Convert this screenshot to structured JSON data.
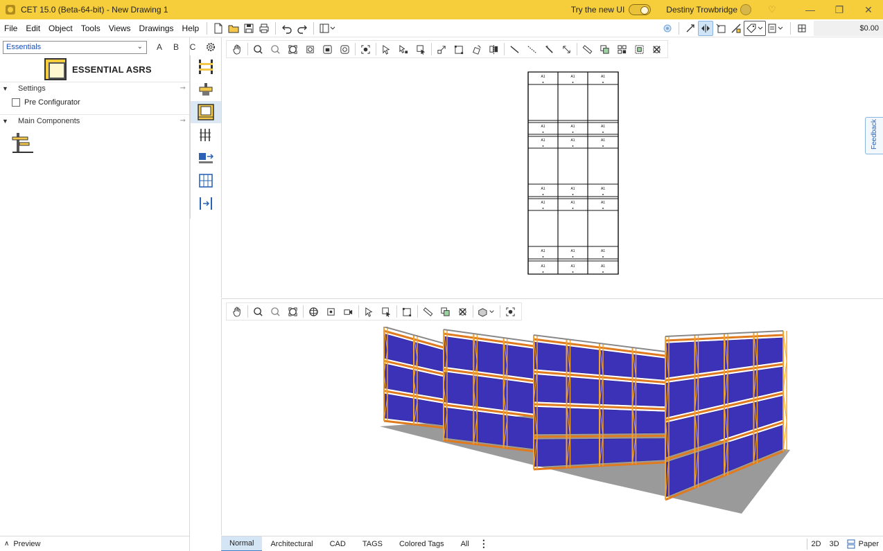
{
  "window": {
    "title": "CET 15.0 (Beta-64-bit) - New Drawing 1",
    "try_new_ui": "Try the new UI",
    "user": "Destiny Trowbridge"
  },
  "menu": [
    "File",
    "Edit",
    "Object",
    "Tools",
    "Views",
    "Drawings",
    "Help"
  ],
  "toolbar": {
    "price": "$0.00"
  },
  "library": {
    "selector_value": "Essentials",
    "abc": [
      "A",
      "B",
      "C"
    ],
    "title": "ESSENTIAL ASRS",
    "sections": {
      "settings": "Settings",
      "main_components": "Main Components"
    },
    "pre_configurator": "Pre Configurator",
    "preview": "Preview"
  },
  "plan_labels": "A1",
  "feedback": "Feedback",
  "status": {
    "tabs": [
      "Normal",
      "Architectural",
      "CAD",
      "TAGS",
      "Colored Tags",
      "All"
    ],
    "active_tab": "Normal",
    "view_2d": "2D",
    "view_3d": "3D",
    "paper": "Paper"
  },
  "colors": {
    "titlebar": "#f6ce3c",
    "rack_frame": "#f2a22b",
    "rack_beam": "#e07a1f",
    "pallet_load": "#3b32b8",
    "floor": "#9a9a9a",
    "active_tab": "#d4e6f6"
  }
}
